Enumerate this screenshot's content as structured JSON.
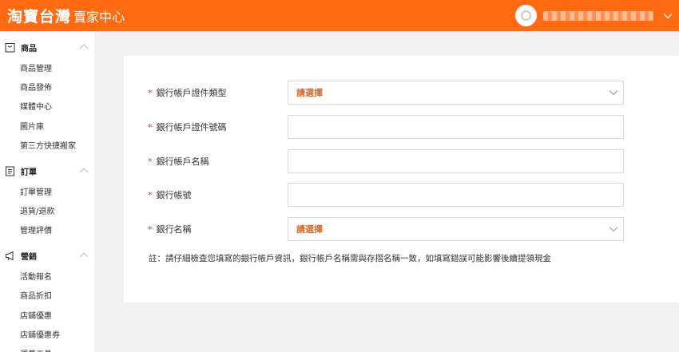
{
  "header": {
    "logo_text": "淘寶台灣",
    "subtitle": "賣家中心",
    "username": ""
  },
  "sidebar": {
    "groups": [
      {
        "label": "商品",
        "icon": "bag-icon",
        "items": [
          "商品管理",
          "商品發佈",
          "媒體中心",
          "圖片庫",
          "第三方快捷搬家"
        ]
      },
      {
        "label": "訂單",
        "icon": "order-list-icon",
        "items": [
          "訂單管理",
          "退貨/退款",
          "管理評價"
        ]
      },
      {
        "label": "營銷",
        "icon": "megaphone-icon",
        "items": [
          "活動報名",
          "商品折扣",
          "店鋪優惠",
          "店鋪優惠券",
          "運費工具"
        ]
      }
    ]
  },
  "form": {
    "fields": [
      {
        "label": "銀行帳戶證件類型",
        "type": "select",
        "value": "請選擇",
        "required": true
      },
      {
        "label": "銀行帳戶證件號碼",
        "type": "input",
        "value": "",
        "required": true
      },
      {
        "label": "銀行帳戶名稱",
        "type": "input",
        "value": "",
        "required": true
      },
      {
        "label": "銀行帳號",
        "type": "input",
        "value": "",
        "required": true
      },
      {
        "label": "銀行名稱",
        "type": "select",
        "value": "請選擇",
        "required": true
      }
    ],
    "required_mark": "*",
    "note": "註：請仔細檢查您填寫的銀行帳戶資訊，銀行帳戶名稱需與存摺名稱一致，如填寫錯誤可能影響後續提領現金"
  },
  "colors": {
    "brand": "#ff6a13",
    "required": "#e5332a",
    "select_placeholder": "#d2692a"
  }
}
